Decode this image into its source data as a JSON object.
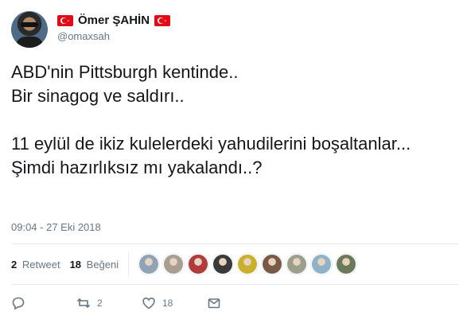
{
  "author": {
    "display_name": "Ömer ŞAHİN",
    "handle": "@omaxsah",
    "flag_icon": "turkey-flag-icon"
  },
  "tweet": {
    "text": "ABD'nin Pittsburgh kentinde..\nBir sinagog ve saldırı..\n\n11 eylül de ikiz kulelerdeki yahudilerini boşaltanlar...\nŞimdi hazırlıksız mı yakalandı..?",
    "timestamp": "09:04 - 27 Eki 2018"
  },
  "stats": {
    "retweets_count": "2",
    "retweets_label": "Retweet",
    "likes_count": "18",
    "likes_label": "Beğeni"
  },
  "likers": [
    {
      "color": "#8fa3b5"
    },
    {
      "color": "#a89f92"
    },
    {
      "color": "#b23b3b"
    },
    {
      "color": "#3a3a3a"
    },
    {
      "color": "#c9b02e"
    },
    {
      "color": "#7a5a44"
    },
    {
      "color": "#9aa08c"
    },
    {
      "color": "#8fb2c9"
    },
    {
      "color": "#6d7a5a"
    }
  ],
  "actions": {
    "reply_icon": "reply-icon",
    "retweet_icon": "retweet-icon",
    "retweet_count": "2",
    "like_icon": "heart-icon",
    "like_count": "18",
    "dm_icon": "envelope-icon"
  },
  "colors": {
    "text": "#14171a",
    "muted": "#657786",
    "divider": "#e6ecf0",
    "flag_red": "#e30a17"
  }
}
